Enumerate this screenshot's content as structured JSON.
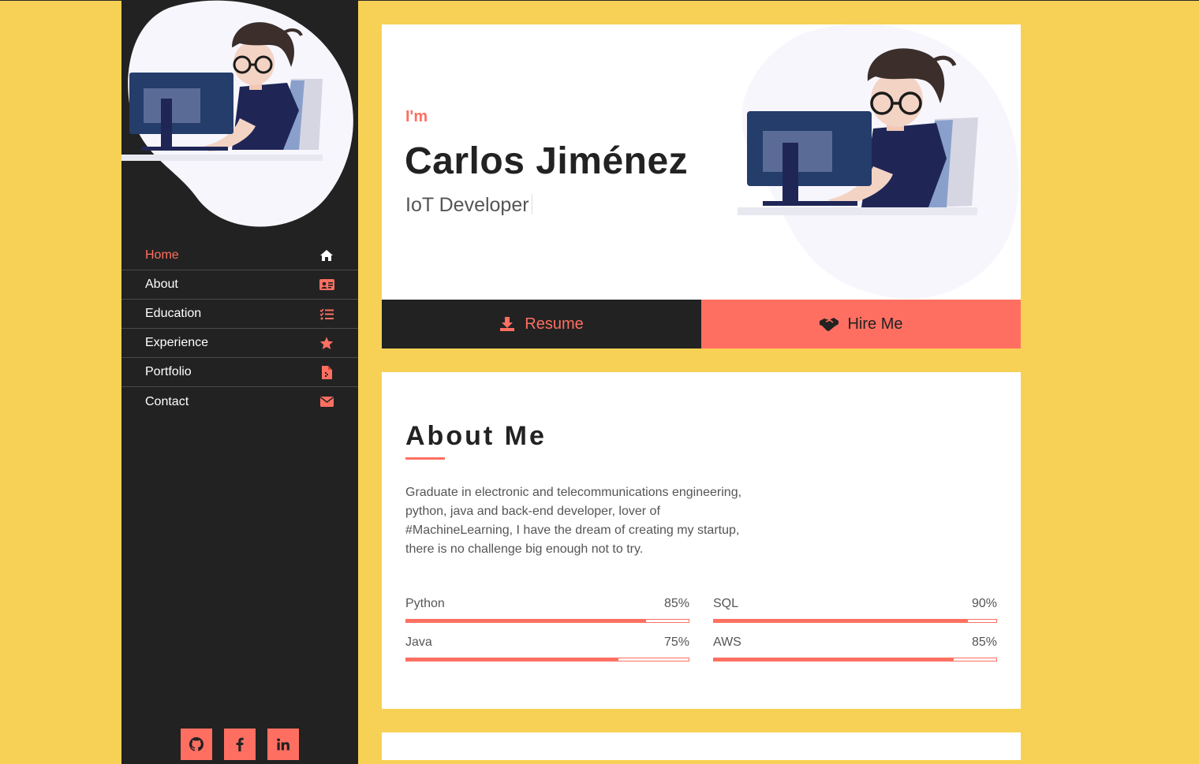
{
  "colors": {
    "accent": "#ff6f61",
    "background": "#f7d155",
    "sidebar": "#222222"
  },
  "sidebar": {
    "avatar_icon": "developer-illustration",
    "items": [
      {
        "label": "Home",
        "icon": "home-icon",
        "active": true
      },
      {
        "label": "About",
        "icon": "id-card-icon",
        "active": false
      },
      {
        "label": "Education",
        "icon": "tasks-icon",
        "active": false
      },
      {
        "label": "Experience",
        "icon": "star-icon",
        "active": false
      },
      {
        "label": "Portfolio",
        "icon": "file-icon",
        "active": false
      },
      {
        "label": "Contact",
        "icon": "envelope-icon",
        "active": false
      }
    ],
    "social": [
      {
        "icon": "github-icon"
      },
      {
        "icon": "facebook-icon"
      },
      {
        "icon": "linkedin-icon"
      }
    ]
  },
  "hero": {
    "intro": "I'm",
    "name": "Carlos Jiménez",
    "role": "IoT Developer",
    "resume_label": "Resume",
    "hire_label": "Hire Me"
  },
  "about": {
    "title": "About Me",
    "text": "Graduate in electronic and telecommunications engineering, python, java and back-end developer, lover of #MachineLearning, I have the dream of creating my startup, there is no challenge big enough not to try.",
    "skills": [
      {
        "name": "Python",
        "percent": "85%",
        "value": 85
      },
      {
        "name": "SQL",
        "percent": "90%",
        "value": 90
      },
      {
        "name": "Java",
        "percent": "75%",
        "value": 75
      },
      {
        "name": "AWS",
        "percent": "85%",
        "value": 85
      }
    ]
  }
}
